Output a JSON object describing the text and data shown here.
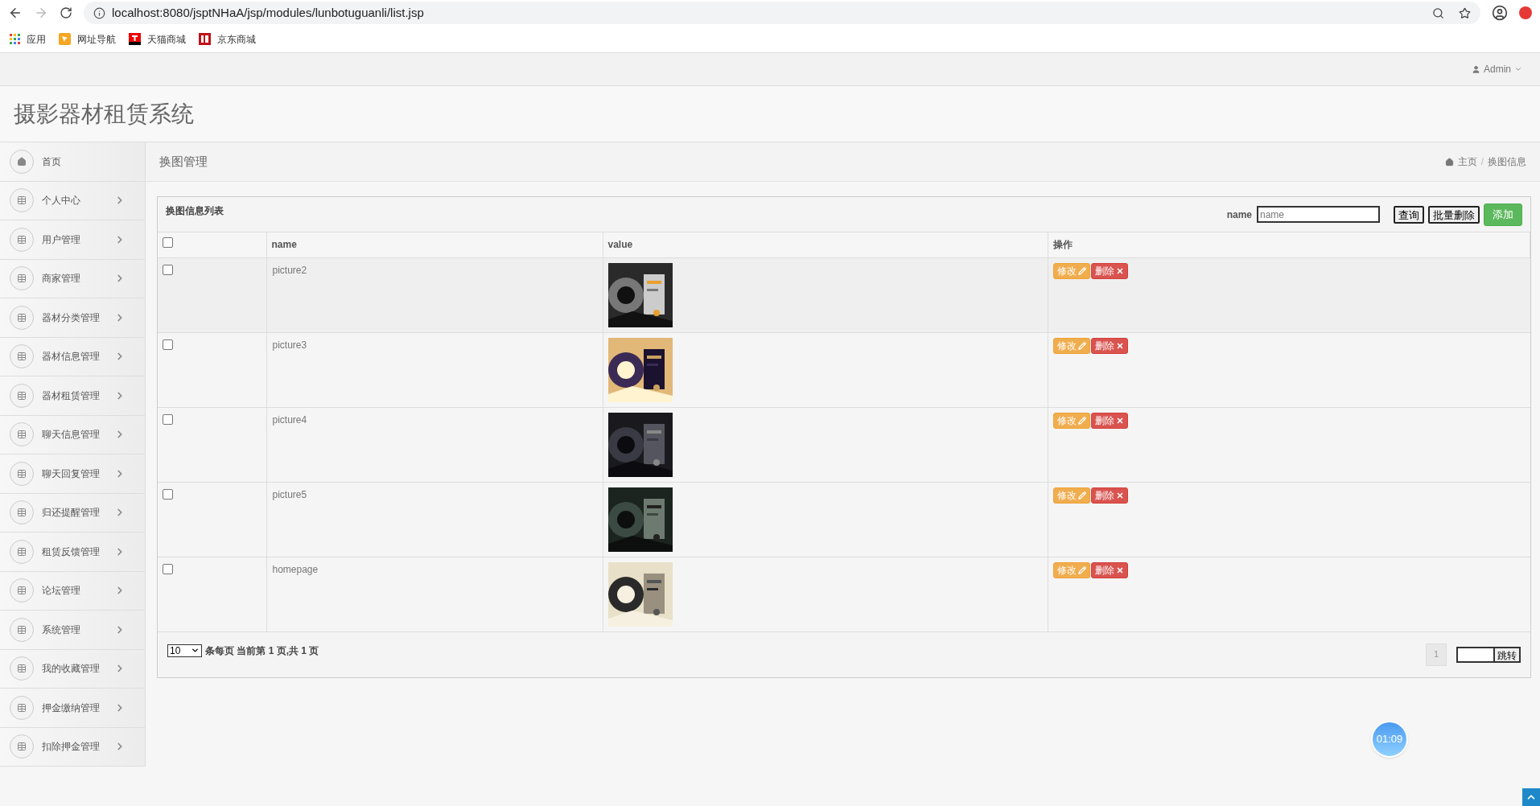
{
  "browser": {
    "url": "localhost:8080/jsptNHaA/jsp/modules/lunbotuguanli/list.jsp",
    "bookmarks": [
      {
        "label": "应用",
        "kind": "apps"
      },
      {
        "label": "网址导航",
        "kind": "nav"
      },
      {
        "label": "天猫商城",
        "kind": "tmall"
      },
      {
        "label": "京东商城",
        "kind": "jd"
      }
    ]
  },
  "topbar": {
    "user": "Admin"
  },
  "app_title": "摄影器材租赁系统",
  "sidebar": {
    "items": [
      {
        "label": "首页",
        "kind": "home"
      },
      {
        "label": "个人中心",
        "kind": "module"
      },
      {
        "label": "用户管理",
        "kind": "module"
      },
      {
        "label": "商家管理",
        "kind": "module"
      },
      {
        "label": "器材分类管理",
        "kind": "module"
      },
      {
        "label": "器材信息管理",
        "kind": "module"
      },
      {
        "label": "器材租赁管理",
        "kind": "module"
      },
      {
        "label": "聊天信息管理",
        "kind": "module"
      },
      {
        "label": "聊天回复管理",
        "kind": "module"
      },
      {
        "label": "归还提醒管理",
        "kind": "module"
      },
      {
        "label": "租赁反馈管理",
        "kind": "module"
      },
      {
        "label": "论坛管理",
        "kind": "module"
      },
      {
        "label": "系统管理",
        "kind": "module"
      },
      {
        "label": "我的收藏管理",
        "kind": "module"
      },
      {
        "label": "押金缴纳管理",
        "kind": "module"
      },
      {
        "label": "扣除押金管理",
        "kind": "module"
      }
    ]
  },
  "page_header": {
    "title": "换图管理",
    "breadcrumb": [
      "主页",
      "换图信息"
    ],
    "breadcrumb_separator": "/"
  },
  "panel": {
    "title": "换图信息列表",
    "search": {
      "label": "name",
      "placeholder": "name"
    },
    "buttons": [
      {
        "label": "查询",
        "kind": "plain"
      },
      {
        "label": "批量删除",
        "kind": "plain"
      },
      {
        "label": "添加",
        "kind": "primary"
      }
    ]
  },
  "table": {
    "select_all": {
      "checked": false
    },
    "columns": [
      "name",
      "value",
      "操作"
    ],
    "rows": [
      {
        "checked": false,
        "name": "picture2",
        "value": {
          "kind": "picture"
        },
        "actions": [
          {
            "label": "修改",
            "kind": "edit"
          },
          {
            "label": "删除",
            "kind": "delete"
          }
        ]
      },
      {
        "checked": false,
        "name": "picture3",
        "value": {
          "kind": "picture"
        },
        "actions": [
          {
            "label": "修改",
            "kind": "edit"
          },
          {
            "label": "删除",
            "kind": "delete"
          }
        ]
      },
      {
        "checked": false,
        "name": "picture4",
        "value": {
          "kind": "picture"
        },
        "actions": [
          {
            "label": "修改",
            "kind": "edit"
          },
          {
            "label": "删除",
            "kind": "delete"
          }
        ]
      },
      {
        "checked": false,
        "name": "picture5",
        "value": {
          "kind": "picture"
        },
        "actions": [
          {
            "label": "修改",
            "kind": "edit"
          },
          {
            "label": "删除",
            "kind": "delete"
          }
        ]
      },
      {
        "checked": false,
        "name": "homepage",
        "value": {
          "kind": "picture"
        },
        "actions": [
          {
            "label": "修改",
            "kind": "edit"
          },
          {
            "label": "删除",
            "kind": "delete"
          }
        ]
      }
    ]
  },
  "pagination": {
    "page_size": "10",
    "info": "条每页 当前第 1 页,共 1 页",
    "pages": [
      {
        "label": "1",
        "selected": true
      }
    ],
    "jump_button": "跳转"
  },
  "timer": "01:09"
}
